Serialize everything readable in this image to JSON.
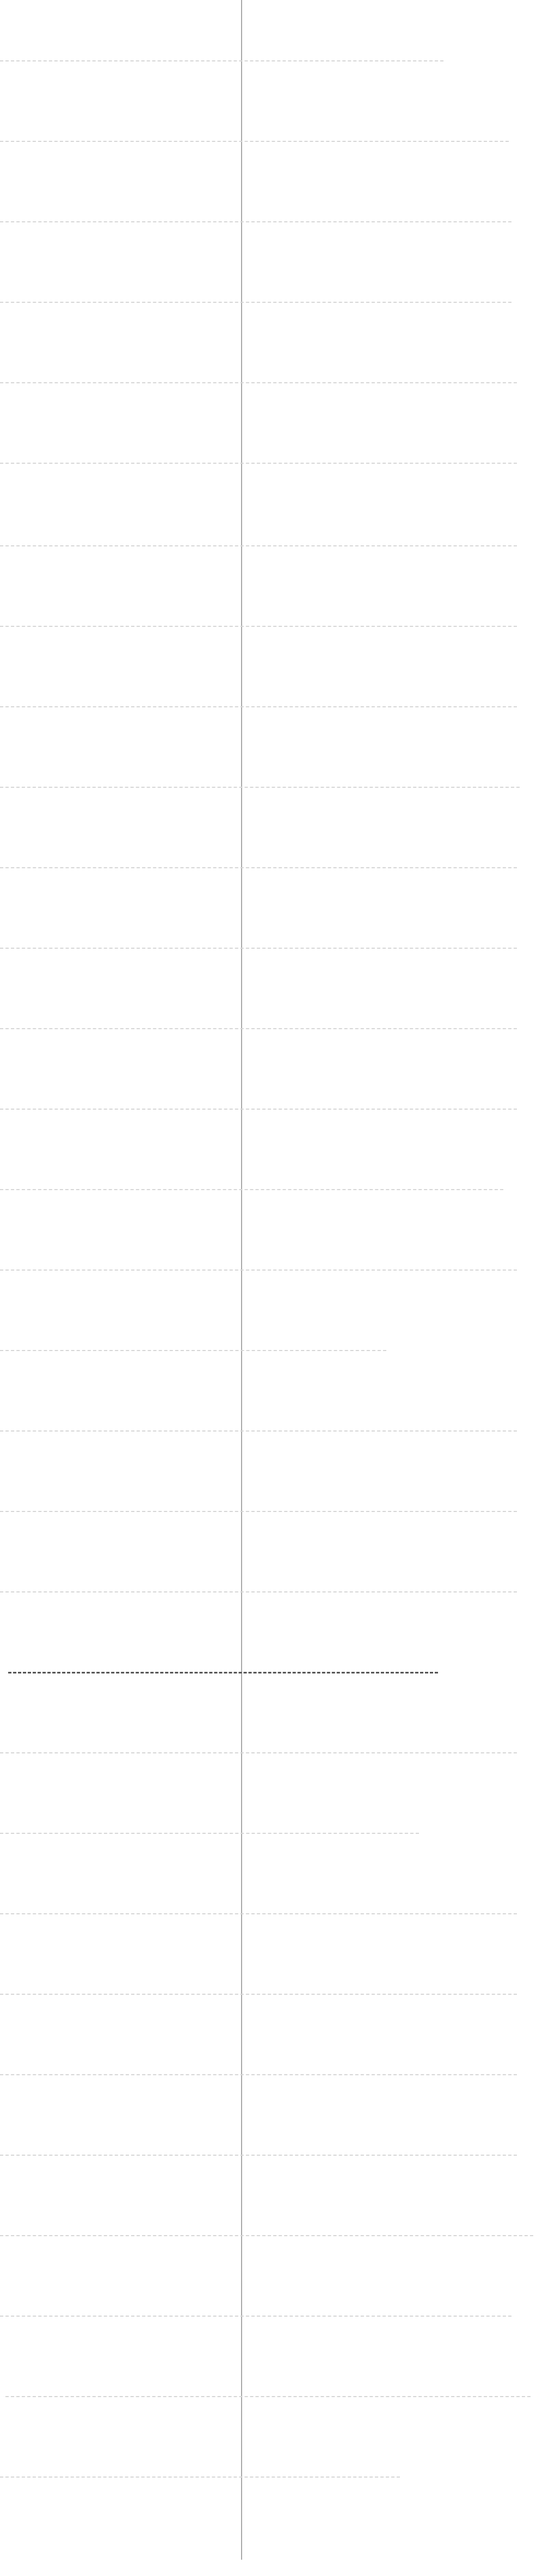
{
  "colors": {
    "background": "#ffffff",
    "divider": "#a8a8a8",
    "dash_light": "#d6d6d6",
    "dash_strong": "#555555"
  },
  "rule_count": 31,
  "emphasized_rule_index": 20
}
